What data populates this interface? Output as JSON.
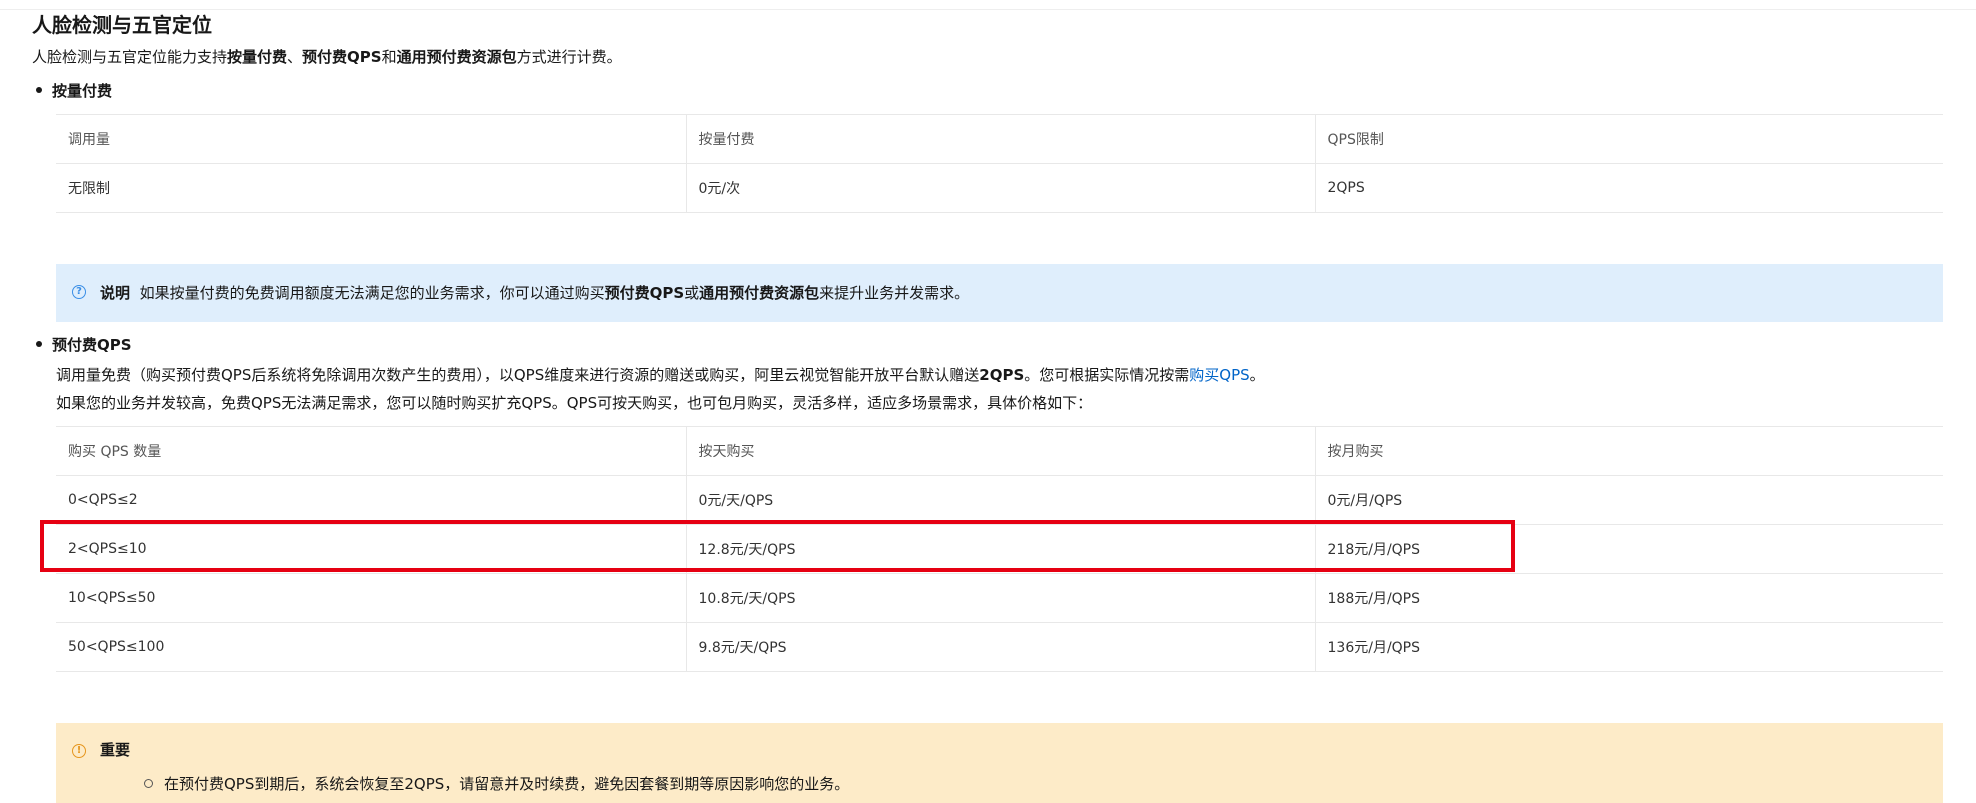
{
  "page": {
    "title": "人脸检测与五官定位",
    "intro": {
      "prefix": "人脸检测与五官定位能力支持",
      "b1": "按量付费",
      "sep1": "、",
      "b2": "预付费QPS",
      "sep2": "和",
      "b3": "通用预付费资源包",
      "suffix": "方式进行计费。"
    }
  },
  "pay_as_you_go": {
    "heading": "按量付费",
    "table": {
      "headers": [
        "调用量",
        "按量付费",
        "QPS限制"
      ],
      "rows": [
        [
          "无限制",
          "0元/次",
          "2QPS"
        ]
      ]
    }
  },
  "note": {
    "label": "说明",
    "text_prefix": "如果按量付费的免费调用额度无法满足您的业务需求，你可以通过购买",
    "bold1": "预付费QPS",
    "mid": "或",
    "bold2": "通用预付费资源包",
    "suffix": "来提升业务并发需求。"
  },
  "prepaid_qps": {
    "heading": "预付费QPS",
    "line1_prefix": "调用量免费（购买预付费QPS后系统将免除调用次数产生的费用），以QPS维度来进行资源的赠送或购买，阿里云视觉智能开放平台默认赠送",
    "line1_bold": "2QPS",
    "line1_mid": "。您可根据实际情况按需",
    "line1_link": "购买QPS",
    "line1_end": "。",
    "line2": "如果您的业务并发较高，免费QPS无法满足需求，您可以随时购买扩充QPS。QPS可按天购买，也可包月购买，灵活多样，适应多场景需求，具体价格如下：",
    "table": {
      "headers": [
        "购买 QPS 数量",
        "按天购买",
        "按月购买"
      ],
      "rows": [
        [
          "0<QPS≤2",
          "0元/天/QPS",
          "0元/月/QPS"
        ],
        [
          "2<QPS≤10",
          "12.8元/天/QPS",
          "218元/月/QPS"
        ],
        [
          "10<QPS≤50",
          "10.8元/天/QPS",
          "188元/月/QPS"
        ],
        [
          "50<QPS≤100",
          "9.8元/天/QPS",
          "136元/月/QPS"
        ]
      ]
    }
  },
  "important": {
    "label": "重要",
    "item1": "在预付费QPS到期后，系统会恢复至2QPS，请留意并及时续费，避免因套餐到期等原因影响您的业务。"
  },
  "highlight": {
    "row_index": 1,
    "color": "#e60012"
  },
  "colors": {
    "link": "#0064c8",
    "note_bg": "#dfeefc",
    "warn_bg": "#fdebc8"
  },
  "icons": {
    "note": "question-circle-icon",
    "warn": "exclamation-circle-icon"
  }
}
